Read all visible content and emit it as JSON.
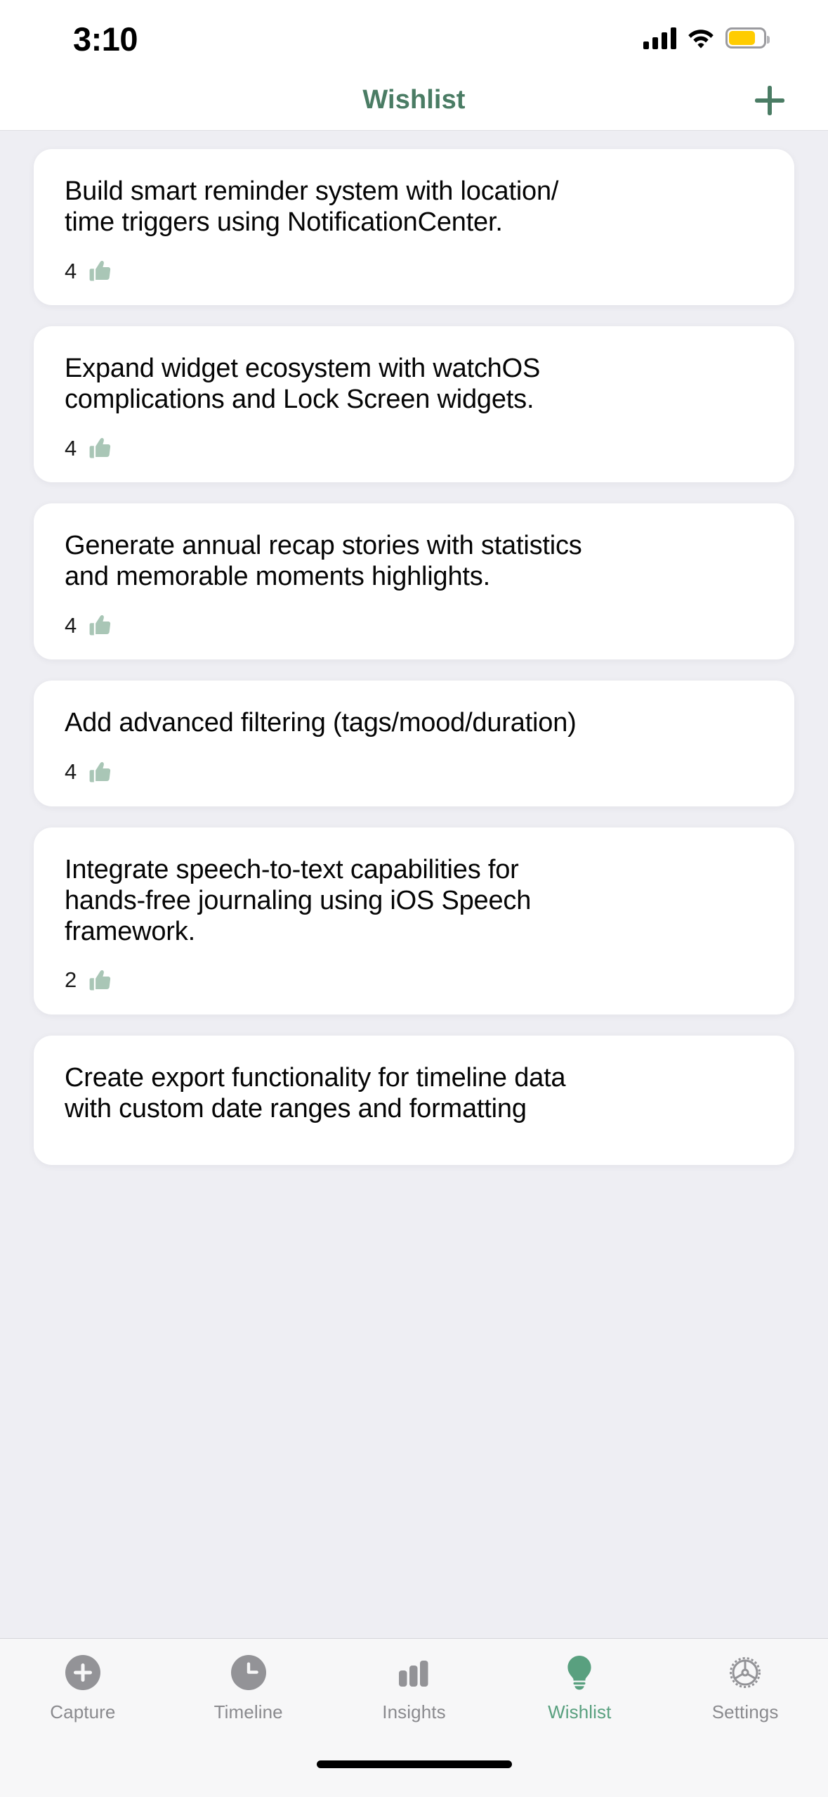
{
  "status_bar": {
    "time": "3:10",
    "signal_icon": "cellular-signal-icon",
    "wifi_icon": "wifi-icon",
    "battery_icon": "battery-icon",
    "battery_color": "#ffcc00"
  },
  "nav": {
    "title": "Wishlist",
    "title_color": "#4a7c64",
    "add_icon": "plus-icon"
  },
  "theme": {
    "background": "#eeeef3",
    "card_background": "#ffffff",
    "accent_green": "#4a7c64",
    "tab_active_green": "#59a07f",
    "thumb_green": "#a9c6b6",
    "inactive_gray": "#8a8a8e"
  },
  "list": {
    "items": [
      {
        "text": "Build smart reminder system with location/\ntime triggers using NotificationCenter.",
        "votes": "4",
        "vote_icon": "thumbs-up-icon"
      },
      {
        "text": "Expand widget ecosystem with watchOS\ncomplications and Lock Screen widgets.",
        "votes": "4",
        "vote_icon": "thumbs-up-icon"
      },
      {
        "text": "Generate annual recap stories with statistics\nand memorable moments highlights.",
        "votes": "4",
        "vote_icon": "thumbs-up-icon"
      },
      {
        "text": "Add advanced filtering (tags/mood/duration)",
        "votes": "4",
        "vote_icon": "thumbs-up-icon"
      },
      {
        "text": "Integrate speech-to-text capabilities for\nhands-free journaling using iOS Speech\nframework.",
        "votes": "2",
        "vote_icon": "thumbs-up-icon"
      },
      {
        "text": "Create export functionality for timeline data\nwith custom date ranges and formatting",
        "votes": "",
        "vote_icon": "thumbs-up-icon"
      }
    ]
  },
  "tab_bar": {
    "tabs": [
      {
        "label": "Capture",
        "icon": "plus-circle-icon",
        "active": false
      },
      {
        "label": "Timeline",
        "icon": "clock-circle-icon",
        "active": false
      },
      {
        "label": "Insights",
        "icon": "bar-chart-icon",
        "active": false
      },
      {
        "label": "Wishlist",
        "icon": "lightbulb-icon",
        "active": true
      },
      {
        "label": "Settings",
        "icon": "gear-icon",
        "active": false
      }
    ]
  }
}
